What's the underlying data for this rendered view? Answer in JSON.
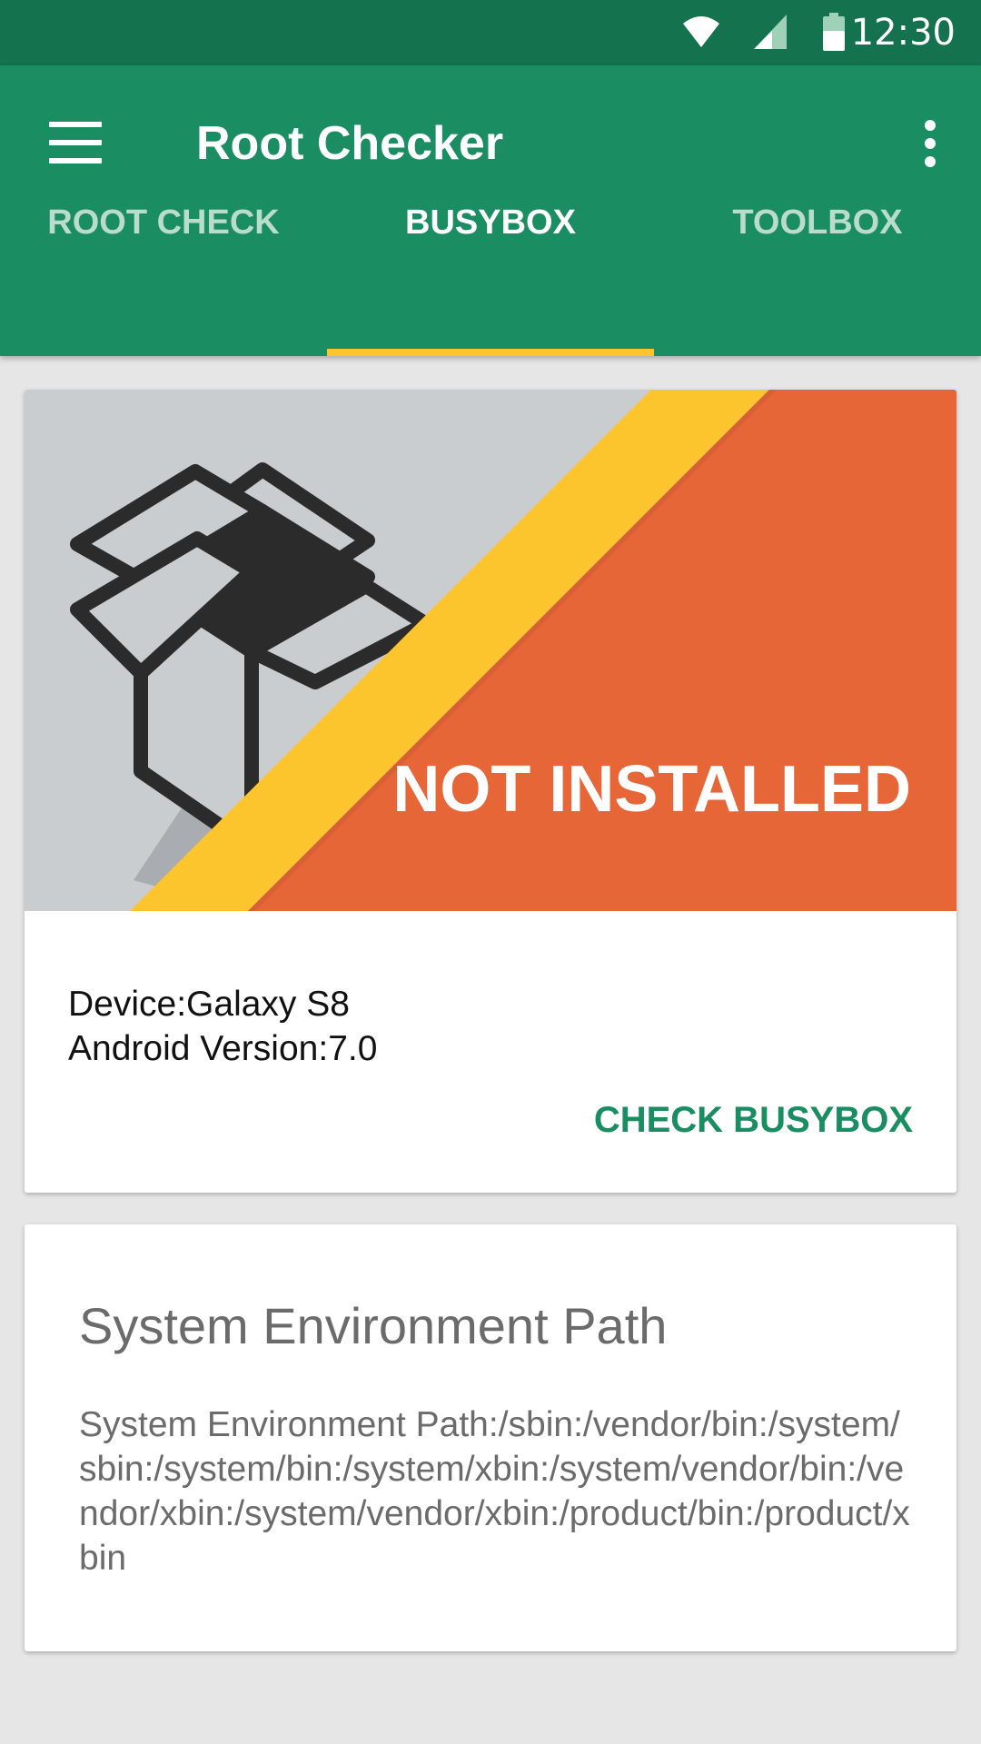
{
  "status_bar": {
    "time": "12:30",
    "icons": [
      "wifi-icon",
      "cell-signal-icon",
      "battery-icon"
    ]
  },
  "app_bar": {
    "title": "Root Checker",
    "menu_icon": "hamburger-menu-icon",
    "overflow_icon": "more-vert-icon"
  },
  "tabs": [
    {
      "label": "ROOT CHECK",
      "active": false
    },
    {
      "label": "BUSYBOX",
      "active": true
    },
    {
      "label": "TOOLBOX",
      "active": false
    }
  ],
  "busybox_card": {
    "status": "NOT INSTALLED",
    "device_label": "Device:",
    "device_value": "Galaxy S8",
    "android_label": "Android Version:",
    "android_value": "7.0",
    "action_label": "CHECK BUSYBOX"
  },
  "path_card": {
    "title": "System Environment Path",
    "body": "System Environment Path:/sbin:/vendor/bin:/system/sbin:/system/bin:/system/xbin:/system/vendor/bin:/vendor/xbin:/system/vendor/xbin:/product/bin:/product/xbin"
  },
  "colors": {
    "status_bar": "#14724f",
    "app_bar": "#1a8d63",
    "accent_yellow": "#fcc52d",
    "banner_orange": "#e66638",
    "banner_gray": "#c9cdd0"
  }
}
